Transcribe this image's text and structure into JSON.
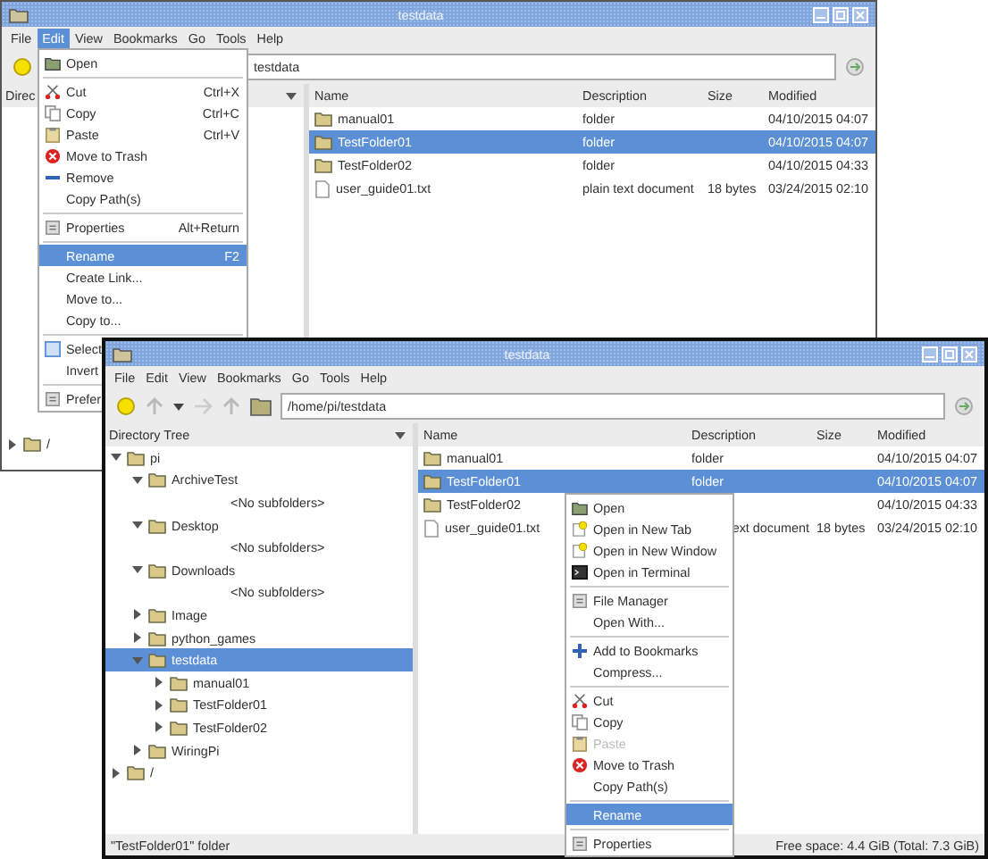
{
  "back_window": {
    "title": "testdata",
    "menu": [
      {
        "label": "File",
        "selected": false
      },
      {
        "label": "Edit",
        "selected": true
      },
      {
        "label": "View",
        "selected": false
      },
      {
        "label": "Bookmarks",
        "selected": false
      },
      {
        "label": "Go",
        "selected": false
      },
      {
        "label": "Tools",
        "selected": false
      },
      {
        "label": "Help",
        "selected": false
      }
    ],
    "path": "testdata",
    "tree_header": "Direc",
    "tree": [
      {
        "label": "/",
        "expanded": false,
        "selected": false
      }
    ],
    "columns": [
      "Name",
      "Description",
      "Size",
      "Modified"
    ],
    "rows": [
      {
        "kind": "folder",
        "name": "manual01",
        "description": "folder",
        "modified": "04/10/2015 04:07",
        "selected": false
      },
      {
        "kind": "folder",
        "name": "TestFolder01",
        "description": "folder",
        "modified": "04/10/2015 04:07",
        "selected": true
      },
      {
        "kind": "folder",
        "name": "TestFolder02",
        "description": "folder",
        "modified": "04/10/2015 04:33",
        "selected": false
      },
      {
        "kind": "file",
        "name": "user_guide01.txt",
        "description": "plain text document",
        "size": "18 bytes",
        "modified": "03/24/2015 02:10",
        "selected": false
      }
    ],
    "edit_menu": [
      {
        "kind": "open",
        "label": "Open",
        "selected": false,
        "disabled": false
      },
      {
        "kind": "separator"
      },
      {
        "kind": "cut",
        "label": "Cut",
        "shortcut": "Ctrl+X",
        "selected": false,
        "disabled": false
      },
      {
        "kind": "copy",
        "label": "Copy",
        "shortcut": "Ctrl+C",
        "selected": false,
        "disabled": false
      },
      {
        "kind": "paste",
        "label": "Paste",
        "shortcut": "Ctrl+V",
        "selected": false,
        "disabled": false
      },
      {
        "kind": "trash",
        "label": "Move to Trash",
        "selected": false,
        "disabled": false
      },
      {
        "kind": "remove",
        "label": "Remove",
        "selected": false,
        "disabled": false
      },
      {
        "kind": "plain",
        "label": "Copy Path(s)",
        "selected": false,
        "disabled": false
      },
      {
        "kind": "separator"
      },
      {
        "kind": "settings",
        "label": "Properties",
        "shortcut": "Alt+Return",
        "selected": false,
        "disabled": false
      },
      {
        "kind": "separator"
      },
      {
        "kind": "plain",
        "label": "Rename",
        "shortcut": "F2",
        "selected": true,
        "disabled": false
      },
      {
        "kind": "plain",
        "label": "Create Link...",
        "selected": false,
        "disabled": false
      },
      {
        "kind": "plain",
        "label": "Move to...",
        "selected": false,
        "disabled": false
      },
      {
        "kind": "plain",
        "label": "Copy to...",
        "selected": false,
        "disabled": false
      },
      {
        "kind": "separator"
      },
      {
        "kind": "select",
        "label": "Select",
        "selected": false,
        "disabled": false
      },
      {
        "kind": "plain",
        "label": "Invert",
        "selected": false,
        "disabled": false
      },
      {
        "kind": "separator"
      },
      {
        "kind": "settings",
        "label": "Prefer",
        "selected": false,
        "disabled": false
      }
    ]
  },
  "front_window": {
    "title": "testdata",
    "menu": [
      {
        "label": "File",
        "selected": false
      },
      {
        "label": "Edit",
        "selected": false
      },
      {
        "label": "View",
        "selected": false
      },
      {
        "label": "Bookmarks",
        "selected": false
      },
      {
        "label": "Go",
        "selected": false
      },
      {
        "label": "Tools",
        "selected": false
      },
      {
        "label": "Help",
        "selected": false
      }
    ],
    "path": "/home/pi/testdata",
    "tree_header": "Directory Tree",
    "tree": [
      {
        "label": "pi",
        "expanded": true,
        "selected": false,
        "children": [
          {
            "label": "ArchiveTest",
            "expanded": true,
            "selected": false,
            "children": [
              {
                "kind": "placeholder",
                "label": "<No subfolders>"
              }
            ]
          },
          {
            "label": "Desktop",
            "expanded": true,
            "selected": false,
            "children": [
              {
                "kind": "placeholder",
                "label": "<No subfolders>"
              }
            ]
          },
          {
            "label": "Downloads",
            "expanded": true,
            "selected": false,
            "children": [
              {
                "kind": "placeholder",
                "label": "<No subfolders>"
              }
            ]
          },
          {
            "label": "Image",
            "expanded": false,
            "selected": false
          },
          {
            "label": "python_games",
            "expanded": false,
            "selected": false
          },
          {
            "label": "testdata",
            "expanded": true,
            "selected": true,
            "children": [
              {
                "label": "manual01",
                "expanded": false,
                "selected": false
              },
              {
                "label": "TestFolder01",
                "expanded": false,
                "selected": false
              },
              {
                "label": "TestFolder02",
                "expanded": false,
                "selected": false
              }
            ]
          },
          {
            "label": "WiringPi",
            "expanded": false,
            "selected": false
          }
        ]
      },
      {
        "label": "/",
        "expanded": false,
        "selected": false
      }
    ],
    "columns": [
      "Name",
      "Description",
      "Size",
      "Modified"
    ],
    "rows": [
      {
        "kind": "folder",
        "name": "manual01",
        "description": "folder",
        "modified": "04/10/2015 04:07",
        "selected": false
      },
      {
        "kind": "folder",
        "name": "TestFolder01",
        "description": "folder",
        "modified": "04/10/2015 04:07",
        "selected": true
      },
      {
        "kind": "folder",
        "name": "TestFolder02",
        "modified": "04/10/2015 04:33",
        "selected": false
      },
      {
        "kind": "file",
        "name": "user_guide01.txt",
        "description": "ext document",
        "size": "18 bytes",
        "modified": "03/24/2015 02:10",
        "selected": false
      }
    ],
    "status_left": "\"TestFolder01\" folder",
    "status_right": "Free space: 4.4 GiB (Total: 7.3 GiB)",
    "context_menu": [
      {
        "kind": "open",
        "label": "Open",
        "selected": false,
        "disabled": false
      },
      {
        "kind": "tab",
        "label": "Open in New Tab",
        "selected": false,
        "disabled": false
      },
      {
        "kind": "tab",
        "label": "Open in New Window",
        "selected": false,
        "disabled": false
      },
      {
        "kind": "terminal",
        "label": "Open in Terminal",
        "selected": false,
        "disabled": false
      },
      {
        "kind": "separator"
      },
      {
        "kind": "settings",
        "label": "File Manager",
        "selected": false,
        "disabled": false
      },
      {
        "kind": "plain",
        "label": "Open With...",
        "selected": false,
        "disabled": false
      },
      {
        "kind": "separator"
      },
      {
        "kind": "bookmark",
        "label": "Add to Bookmarks",
        "selected": false,
        "disabled": false
      },
      {
        "kind": "plain",
        "label": "Compress...",
        "selected": false,
        "disabled": false
      },
      {
        "kind": "separator"
      },
      {
        "kind": "cut",
        "label": "Cut",
        "selected": false,
        "disabled": false
      },
      {
        "kind": "copy",
        "label": "Copy",
        "selected": false,
        "disabled": false
      },
      {
        "kind": "paste",
        "label": "Paste",
        "selected": false,
        "disabled": true
      },
      {
        "kind": "trash",
        "label": "Move to Trash",
        "selected": false,
        "disabled": false
      },
      {
        "kind": "plain",
        "label": "Copy Path(s)",
        "selected": false,
        "disabled": false
      },
      {
        "kind": "separator"
      },
      {
        "kind": "plain",
        "label": "Rename",
        "selected": true,
        "disabled": false
      },
      {
        "kind": "separator"
      },
      {
        "kind": "settings",
        "label": "Properties",
        "selected": false,
        "disabled": false
      }
    ]
  }
}
